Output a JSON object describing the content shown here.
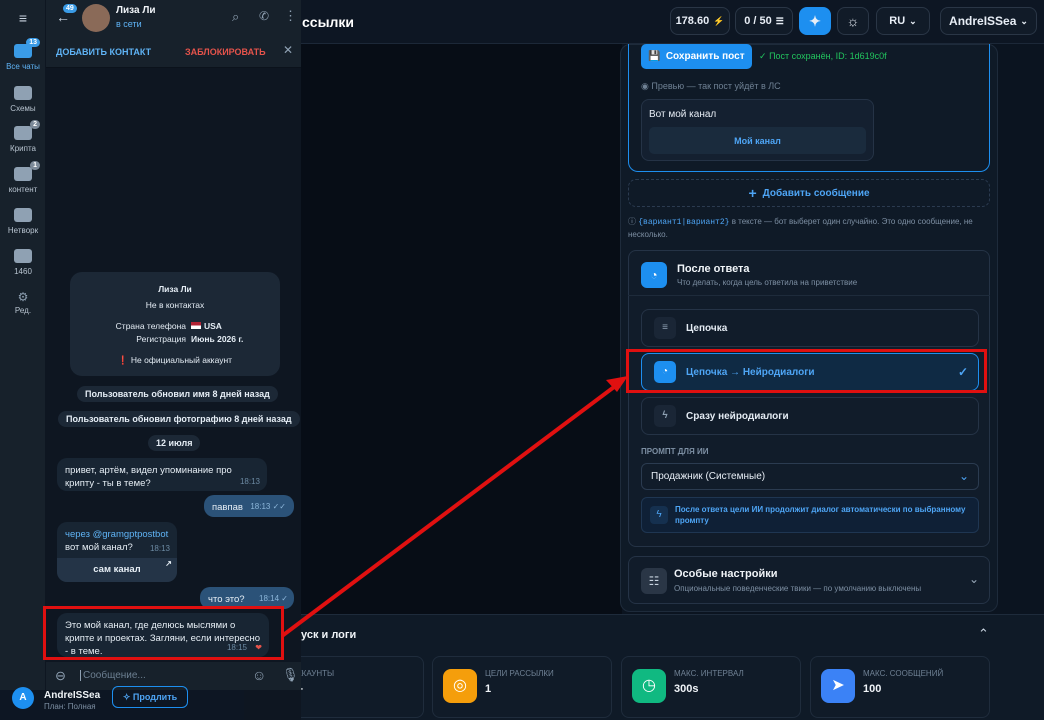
{
  "topbar": {
    "title_partial": "ссылки",
    "balance": "178.60",
    "counter": "0 / 50",
    "lang": "RU",
    "user": "AndreISSea"
  },
  "telegram": {
    "back_badge": "49",
    "contact_name": "Лиза Ли",
    "status": "в сети",
    "add_contact": "ДОБАВИТЬ КОНТАКТ",
    "block": "ЗАБЛОКИРОВАТЬ",
    "rail": [
      {
        "label": "Все чаты",
        "badge": "13"
      },
      {
        "label": "Схемы",
        "badge": ""
      },
      {
        "label": "Крипта",
        "badge": "2"
      },
      {
        "label": "контент",
        "badge": "1"
      },
      {
        "label": "Нетворк",
        "badge": ""
      },
      {
        "label": "1460",
        "badge": ""
      },
      {
        "label": "Ред.",
        "badge": ""
      }
    ],
    "info": {
      "name": "Лиза Ли",
      "not_in_contacts": "Не в контактах",
      "phone_country_label": "Страна телефона",
      "phone_country_value": "USA",
      "registration_label": "Регистрация",
      "registration_value": "Июнь 2026 г.",
      "unofficial": "Не официальный аккаунт"
    },
    "sys1": "Пользователь обновил имя 8 дней назад",
    "sys2": "Пользователь обновил фотографию 8 дней назад",
    "date": "12 июля",
    "msg1": {
      "text": "привет, артём, видел упоминание про крипту - ты в теме?",
      "time": "18:13"
    },
    "msg2": {
      "text": "павпав",
      "time": "18:13"
    },
    "msg3": {
      "via": "через @gramgptpostbot",
      "text": "вот мой канал?",
      "time": "18:13",
      "button": "сам канал"
    },
    "msg4": {
      "text": "что это?",
      "time": "18:14"
    },
    "msg5": {
      "text": "Это мой канал, где делюсь мыслями о крипте и проектах. Загляни, если интересно - в теме.",
      "time": "18:15"
    },
    "input_placeholder": "Сообщение...",
    "bottom_user": "AndreISSea",
    "bottom_plan": "План: Полная",
    "bottom_button": "Продлить",
    "avatar_letter": "A"
  },
  "editor": {
    "save_button": "Сохранить пост",
    "saved_status": "Пост сохранён, ID: 1d619c0f",
    "preview_label": "Превью — так пост уйдёт в ЛС",
    "preview_text": "Вот мой канал",
    "preview_button": "Мой канал",
    "add_message": "Добавить сообщение",
    "hint_code": "{вариант1|вариант2}",
    "hint_text": "в тексте — бот выберет один случайно. Это одно сообщение, не несколько.",
    "after_reply_title": "После ответа",
    "after_reply_sub": "Что делать, когда цель ответила на приветствие",
    "options": [
      "Цепочка",
      "Цепочка → Нейродиалоги",
      "Сразу нейродиалоги"
    ],
    "prompt_label": "ПРОМПТ ДЛЯ ИИ",
    "prompt_value": "Продажник (Системные)",
    "prompt_note": "После ответа цели ИИ продолжит диалог автоматически по выбранному промпту",
    "special_title": "Особые настройки",
    "special_sub": "Опциональные поведенческие твики — по умолчанию выключены"
  },
  "launch": {
    "title_partial": "уск и логи",
    "stats": [
      {
        "label": "ккаунты",
        "value": "–",
        "color": "#2563eb"
      },
      {
        "label": "Цели рассылки",
        "value": "1",
        "color": "#f59e0b"
      },
      {
        "label": "Макс. интервал",
        "value": "300s",
        "color": "#10b981"
      },
      {
        "label": "Макс. сообщений",
        "value": "100",
        "color": "#3b82f6"
      }
    ]
  },
  "colors": {
    "accent": "#1d8ff0",
    "highlight": "#e01010",
    "success": "#22c55e"
  }
}
